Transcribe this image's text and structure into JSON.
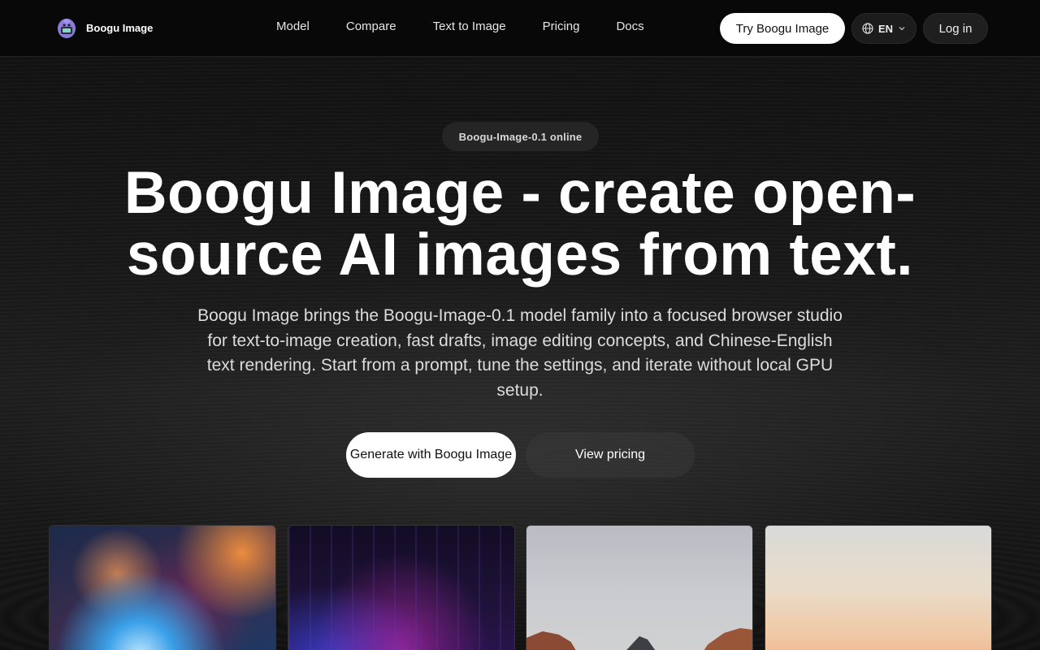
{
  "header": {
    "brand_name": "Boogu Image",
    "nav": [
      {
        "label": "Model"
      },
      {
        "label": "Compare"
      },
      {
        "label": "Text to Image"
      },
      {
        "label": "Pricing"
      },
      {
        "label": "Docs"
      }
    ],
    "try_label": "Try Boogu Image",
    "lang_label": "EN",
    "login_label": "Log in"
  },
  "hero": {
    "badge": "Boogu-Image-0.1 online",
    "headline_line1": "Boogu Image - create open-",
    "headline_line2": "source AI images from text.",
    "subtitle": "Boogu Image brings the Boogu-Image-0.1 model family into a focused browser studio for text-to-image creation, fast drafts, image editing concepts, and Chinese-English text rendering. Start from a prompt, tune the settings, and iterate without local GPU setup.",
    "cta_primary": "Generate with Boogu Image",
    "cta_secondary": "View pricing"
  },
  "icons": {
    "brand": "mascot-logo-icon",
    "lang": "globe-icon",
    "chevron": "chevron-down-icon"
  },
  "colors": {
    "background": "#0b0b0b",
    "primary_button": "#ffffff",
    "badge_bg": "#252525"
  }
}
